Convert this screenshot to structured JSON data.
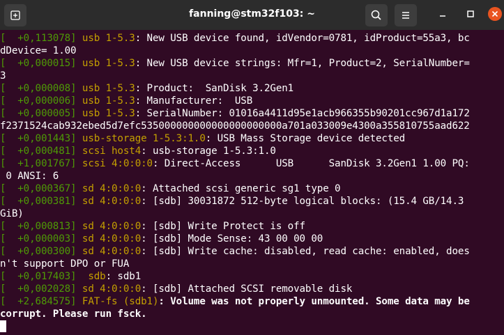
{
  "window": {
    "title": "fanning@stm32f103: ~"
  },
  "icons": {
    "new_tab": "new-tab-icon",
    "search": "search-icon",
    "menu": "hamburger-menu-icon",
    "minimize": "minimize-icon",
    "maximize": "maximize-icon",
    "close": "close-icon"
  },
  "colors": {
    "background": "#300a24",
    "timestamp": "#4e9a06",
    "subsystem": "#c4a000",
    "text": "#ffffff",
    "close_button": "#e95420"
  },
  "lines": [
    {
      "ts": "[  +0,113078]",
      "tag": " usb 1-5.3",
      "text": ": New USB device found, idVendor=0781, idProduct=55a3, bc"
    },
    {
      "ts": "",
      "tag": "",
      "text": "dDevice= 1.00"
    },
    {
      "ts": "[  +0,000015]",
      "tag": " usb 1-5.3",
      "text": ": New USB device strings: Mfr=1, Product=2, SerialNumber="
    },
    {
      "ts": "",
      "tag": "",
      "text": "3"
    },
    {
      "ts": "[  +0,000008]",
      "tag": " usb 1-5.3",
      "text": ": Product:  SanDisk 3.2Gen1"
    },
    {
      "ts": "[  +0,000006]",
      "tag": " usb 1-5.3",
      "text": ": Manufacturer:  USB"
    },
    {
      "ts": "[  +0,000005]",
      "tag": " usb 1-5.3",
      "text": ": SerialNumber: 01016a4411d95e1acb966355b90201cc967d1a172"
    },
    {
      "ts": "",
      "tag": "",
      "text": "f2371524cab932ebed5d7efc535000000000000000000000a701a033009e4300a355810755aad622"
    },
    {
      "ts": "[  +0,001443]",
      "tag": " usb-storage 1-5.3:1.0",
      "text": ": USB Mass Storage device detected"
    },
    {
      "ts": "[  +0,000481]",
      "tag": " scsi host4",
      "text": ": usb-storage 1-5.3:1.0"
    },
    {
      "ts": "[  +1,001767]",
      "tag": " scsi 4:0:0:0",
      "text": ": Direct-Access      USB      SanDisk 3.2Gen1 1.00 PQ:"
    },
    {
      "ts": "",
      "tag": "",
      "text": " 0 ANSI: 6"
    },
    {
      "ts": "[  +0,000367]",
      "tag": " sd 4:0:0:0",
      "text": ": Attached scsi generic sg1 type 0"
    },
    {
      "ts": "[  +0,000381]",
      "tag": " sd 4:0:0:0",
      "text": ": [sdb] 30031872 512-byte logical blocks: (15.4 GB/14.3"
    },
    {
      "ts": "",
      "tag": "",
      "text": "GiB)"
    },
    {
      "ts": "[  +0,000813]",
      "tag": " sd 4:0:0:0",
      "text": ": [sdb] Write Protect is off"
    },
    {
      "ts": "[  +0,000003]",
      "tag": " sd 4:0:0:0",
      "text": ": [sdb] Mode Sense: 43 00 00 00"
    },
    {
      "ts": "[  +0,000300]",
      "tag": " sd 4:0:0:0",
      "text": ": [sdb] Write cache: disabled, read cache: enabled, does"
    },
    {
      "ts": "",
      "tag": "",
      "text": "n't support DPO or FUA"
    },
    {
      "ts": "[  +0,017403]",
      "tag": "  sdb",
      "text": ": sdb1"
    },
    {
      "ts": "[  +0,002028]",
      "tag": " sd 4:0:0:0",
      "text": ": [sdb] Attached SCSI removable disk"
    },
    {
      "ts": "[  +2,684575]",
      "tag": " FAT-fs (sdb1)",
      "text": ": Volume was not properly unmounted. Some data may be",
      "bold": true
    },
    {
      "ts": "",
      "tag": "",
      "text": "corrupt. Please run fsck.",
      "bold": true
    }
  ]
}
